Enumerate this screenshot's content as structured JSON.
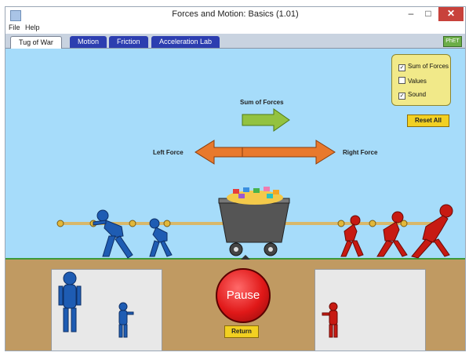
{
  "window": {
    "title": "Forces and Motion: Basics (1.01)",
    "minimize_glyph": "–",
    "maximize_glyph": "□",
    "close_glyph": "✕"
  },
  "menu": {
    "items": [
      "File",
      "Help"
    ]
  },
  "tabs": [
    {
      "label": "Tug of War",
      "active": true
    },
    {
      "label": "Motion",
      "active": false
    },
    {
      "label": "Friction",
      "active": false
    },
    {
      "label": "Acceleration Lab",
      "active": false
    }
  ],
  "scene": {
    "sum_of_forces_label": "Sum of Forces",
    "left_force_label": "Left Force",
    "right_force_label": "Right Force"
  },
  "controls": {
    "checkboxes": [
      {
        "label": "Sum of Forces",
        "checked": true
      },
      {
        "label": "Values",
        "checked": false
      },
      {
        "label": "Sound",
        "checked": true
      }
    ],
    "reset_all_label": "Reset All",
    "pause_label": "Pause",
    "return_label": "Return"
  },
  "colors": {
    "sky": "#a6dcfa",
    "ground": "#c09a62",
    "blue_team": "#1e5cb3",
    "red_team": "#c71a12",
    "force_arrow": "#e8792d",
    "sum_arrow": "#93c240"
  }
}
